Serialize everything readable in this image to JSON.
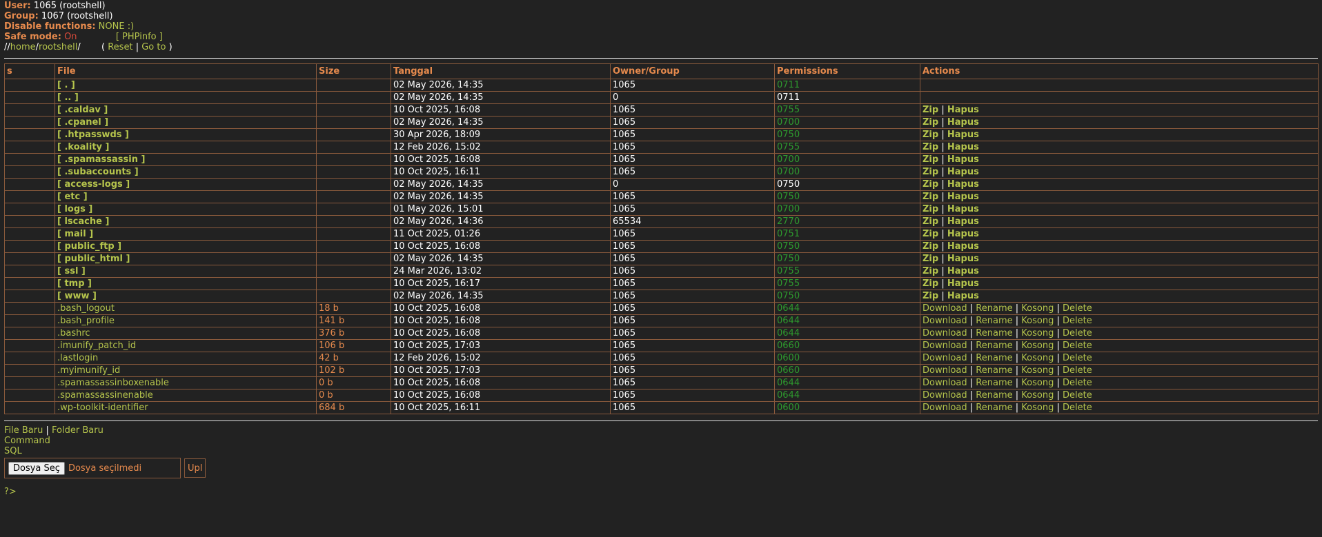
{
  "info": {
    "user_label": "User:",
    "user_value": "1065 (rootshell)",
    "group_label": "Group:",
    "group_value": "1067 (rootshell)",
    "disable_label": "Disable functions:",
    "disable_value": "NONE :)",
    "safe_label": "Safe mode:",
    "safe_value": "On",
    "phpinfo_link": "[ PHPinfo ]",
    "path_root": "//",
    "path_home": "home",
    "path_sep1": "/",
    "path_user": "rootshell",
    "path_sep2": "/",
    "path_open": "(",
    "reset_link": "Reset",
    "path_pipe": "|",
    "goto_link": "Go to",
    "path_close": ")"
  },
  "table": {
    "headers": [
      "s",
      "File",
      "Size",
      "Tanggal",
      "Owner/Group",
      "Permissions",
      "Actions"
    ],
    "dirs": [
      {
        "name": "[ . ]",
        "date": "02 May 2026, 14:35",
        "owner": "1065",
        "perm": "0711",
        "perm_color": "green",
        "actions": false
      },
      {
        "name": "[ .. ]",
        "date": "02 May 2026, 14:35",
        "owner": "0",
        "perm": "0711",
        "perm_color": "white",
        "actions": false
      },
      {
        "name": "[ .caldav ]",
        "date": "10 Oct 2025, 16:08",
        "owner": "1065",
        "perm": "0755",
        "perm_color": "green",
        "actions": true
      },
      {
        "name": "[ .cpanel ]",
        "date": "02 May 2026, 14:35",
        "owner": "1065",
        "perm": "0700",
        "perm_color": "green",
        "actions": true
      },
      {
        "name": "[ .htpasswds ]",
        "date": "30 Apr 2026, 18:09",
        "owner": "1065",
        "perm": "0750",
        "perm_color": "green",
        "actions": true
      },
      {
        "name": "[ .koality ]",
        "date": "12 Feb 2026, 15:02",
        "owner": "1065",
        "perm": "0755",
        "perm_color": "green",
        "actions": true
      },
      {
        "name": "[ .spamassassin ]",
        "date": "10 Oct 2025, 16:08",
        "owner": "1065",
        "perm": "0700",
        "perm_color": "green",
        "actions": true
      },
      {
        "name": "[ .subaccounts ]",
        "date": "10 Oct 2025, 16:11",
        "owner": "1065",
        "perm": "0700",
        "perm_color": "green",
        "actions": true
      },
      {
        "name": "[ access-logs ]",
        "date": "02 May 2026, 14:35",
        "owner": "0",
        "perm": "0750",
        "perm_color": "white",
        "actions": true
      },
      {
        "name": "[ etc ]",
        "date": "02 May 2026, 14:35",
        "owner": "1065",
        "perm": "0750",
        "perm_color": "green",
        "actions": true
      },
      {
        "name": "[ logs ]",
        "date": "01 May 2026, 15:01",
        "owner": "1065",
        "perm": "0700",
        "perm_color": "green",
        "actions": true
      },
      {
        "name": "[ lscache ]",
        "date": "02 May 2026, 14:36",
        "owner": "65534",
        "perm": "2770",
        "perm_color": "green",
        "actions": true
      },
      {
        "name": "[ mail ]",
        "date": "11 Oct 2025, 01:26",
        "owner": "1065",
        "perm": "0751",
        "perm_color": "green",
        "actions": true
      },
      {
        "name": "[ public_ftp ]",
        "date": "10 Oct 2025, 16:08",
        "owner": "1065",
        "perm": "0750",
        "perm_color": "green",
        "actions": true
      },
      {
        "name": "[ public_html ]",
        "date": "02 May 2026, 14:35",
        "owner": "1065",
        "perm": "0750",
        "perm_color": "green",
        "actions": true
      },
      {
        "name": "[ ssl ]",
        "date": "24 Mar 2026, 13:02",
        "owner": "1065",
        "perm": "0755",
        "perm_color": "green",
        "actions": true
      },
      {
        "name": "[ tmp ]",
        "date": "10 Oct 2025, 16:17",
        "owner": "1065",
        "perm": "0755",
        "perm_color": "green",
        "actions": true
      },
      {
        "name": "[ www ]",
        "date": "02 May 2026, 14:35",
        "owner": "1065",
        "perm": "0750",
        "perm_color": "green",
        "actions": true
      }
    ],
    "files": [
      {
        "name": ".bash_logout",
        "size": "18 b",
        "date": "10 Oct 2025, 16:08",
        "owner": "1065",
        "perm": "0644"
      },
      {
        "name": ".bash_profile",
        "size": "141 b",
        "date": "10 Oct 2025, 16:08",
        "owner": "1065",
        "perm": "0644"
      },
      {
        "name": ".bashrc",
        "size": "376 b",
        "date": "10 Oct 2025, 16:08",
        "owner": "1065",
        "perm": "0644"
      },
      {
        "name": ".imunify_patch_id",
        "size": "106 b",
        "date": "10 Oct 2025, 17:03",
        "owner": "1065",
        "perm": "0660"
      },
      {
        "name": ".lastlogin",
        "size": "42 b",
        "date": "12 Feb 2026, 15:02",
        "owner": "1065",
        "perm": "0600"
      },
      {
        "name": ".myimunify_id",
        "size": "102 b",
        "date": "10 Oct 2025, 17:03",
        "owner": "1065",
        "perm": "0660"
      },
      {
        "name": ".spamassassinboxenable",
        "size": "0 b",
        "date": "10 Oct 2025, 16:08",
        "owner": "1065",
        "perm": "0644"
      },
      {
        "name": ".spamassassinenable",
        "size": "0 b",
        "date": "10 Oct 2025, 16:08",
        "owner": "1065",
        "perm": "0644"
      },
      {
        "name": ".wp-toolkit-identifier",
        "size": "684 b",
        "date": "10 Oct 2025, 16:11",
        "owner": "1065",
        "perm": "0600"
      }
    ],
    "dir_actions": {
      "zip": "Zip",
      "sep": "|",
      "hapus": "Hapus"
    },
    "file_actions": {
      "download": "Download",
      "sep": "|",
      "rename": "Rename",
      "kosong": "Kosong",
      "delete": "Delete"
    }
  },
  "bottom": {
    "file_baru": "File Baru",
    "pipe": "|",
    "folder_baru": "Folder Baru",
    "command": "Command",
    "sql": "SQL",
    "choose_file": "Dosya Seç",
    "no_file": "Dosya seçilmedi",
    "upload": "Upl",
    "tail": "?>"
  },
  "colors": {
    "background": "#222222",
    "label_orange": "#e68a4d",
    "link_green": "#b5c44c",
    "perm_green": "#2e9a2e",
    "safe_red": "#d94a3a",
    "border": "#8a5a3c"
  }
}
